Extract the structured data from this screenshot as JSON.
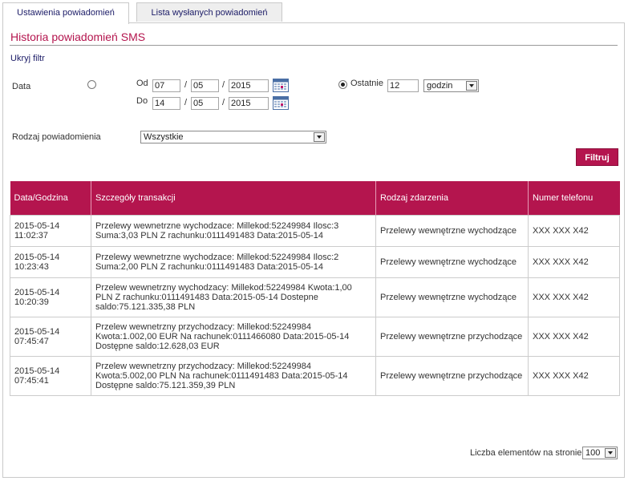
{
  "tabs": [
    {
      "label": "Ustawienia powiadomień",
      "active": true
    },
    {
      "label": "Lista wysłanych powiadomień",
      "active": false
    }
  ],
  "page": {
    "title": "Historia powiadomień SMS",
    "hide_filter": "Ukryj filtr"
  },
  "filter": {
    "date_label": "Data",
    "from_label": "Od",
    "to_label": "Do",
    "from": {
      "day": "07",
      "month": "05",
      "year": "2015"
    },
    "to": {
      "day": "14",
      "month": "05",
      "year": "2015"
    },
    "separator": "/",
    "last_label": "Ostatnie",
    "last_value": "12",
    "last_unit": "godzin",
    "type_label": "Rodzaj powiadomienia",
    "type_value": "Wszystkie",
    "filter_button": "Filtruj"
  },
  "table": {
    "headers": [
      "Data/Godzina",
      "Szczegóły transakcji",
      "Rodzaj zdarzenia",
      "Numer telefonu"
    ],
    "rows": [
      {
        "date": "2015-05-14",
        "time": "11:02:37",
        "details": [
          "Przelewy wewnetrzne wychodzace: Millekod:52249984 Ilosc:3",
          "Suma:3,03 PLN Z rachunku:0111491483 Data:2015-05-14"
        ],
        "event": "Przelewy wewnętrzne wychodzące",
        "phone": "XXX XXX X42"
      },
      {
        "date": "2015-05-14",
        "time": "10:23:43",
        "details": [
          "Przelewy wewnetrzne wychodzace: Millekod:52249984 Ilosc:2",
          "Suma:2,00 PLN Z rachunku:0111491483 Data:2015-05-14"
        ],
        "event": "Przelewy wewnętrzne wychodzące",
        "phone": "XXX XXX X42"
      },
      {
        "date": "2015-05-14",
        "time": "10:20:39",
        "details": [
          "Przelew wewnetrzny wychodzacy: Millekod:52249984 Kwota:1,00",
          "PLN Z rachunku:0111491483 Data:2015-05-14 Dostepne",
          "saldo:75.121.335,38 PLN"
        ],
        "event": "Przelewy wewnętrzne wychodzące",
        "phone": "XXX XXX X42"
      },
      {
        "date": "2015-05-14",
        "time": "07:45:47",
        "details": [
          "Przelew wewnetrzny przychodzacy: Millekod:52249984",
          "Kwota:1.002,00 EUR Na rachunek:0111466080 Data:2015-05-14",
          "Dostępne saldo:12.628,03 EUR"
        ],
        "event": "Przelewy wewnętrzne przychodzące",
        "phone": "XXX XXX X42"
      },
      {
        "date": "2015-05-14",
        "time": "07:45:41",
        "details": [
          "Przelew wewnetrzny przychodzacy: Millekod:52249984",
          "Kwota:5.002,00 PLN Na rachunek:0111491483 Data:2015-05-14",
          "Dostępne saldo:75.121.359,39 PLN"
        ],
        "event": "Przelewy wewnętrzne przychodzące",
        "phone": "XXX XXX X42"
      }
    ]
  },
  "pagination": {
    "per_page_label": "Liczba elementów na stronie",
    "per_page_value": "100"
  },
  "colors": {
    "accent": "#b4154e",
    "link": "#1a1a66"
  },
  "icons": {
    "calendar": "calendar-icon",
    "dropdown": "chevron-down-icon"
  }
}
